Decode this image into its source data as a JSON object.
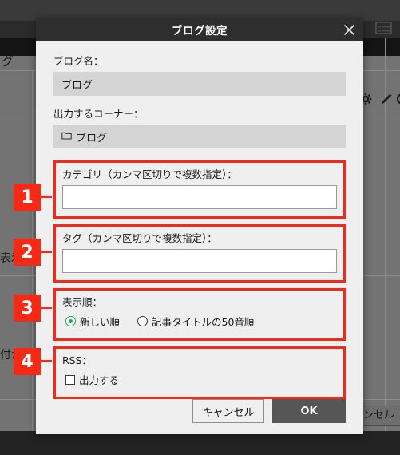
{
  "background": {
    "app_label_partial_top": "グ",
    "app_label_partial_mid": "表示",
    "app_label_partial_low": "付か",
    "cancel_button_partial": "ンセル",
    "icons": {
      "list_icon": "list-icon",
      "gear_icon": "gear-icon",
      "pencil_icon": "pencil-icon",
      "chevron_left_icon": "chevron-left-icon"
    }
  },
  "dialog": {
    "title": "ブログ設定",
    "close_icon": "close-icon",
    "fields": {
      "blog_name": {
        "label": "ブログ名：",
        "value": "ブログ",
        "disabled": true
      },
      "output_corner": {
        "label": "出力するコーナー：",
        "value": "ブログ",
        "icon": "folder-icon",
        "disabled": true
      },
      "category": {
        "label": "カテゴリ（カンマ区切りで複数指定）：",
        "value": "",
        "placeholder": ""
      },
      "tag": {
        "label": "タグ（カンマ区切りで複数指定）：",
        "value": "",
        "placeholder": ""
      },
      "display_order": {
        "label": "表示順：",
        "options": [
          {
            "label": "新しい順",
            "selected": true
          },
          {
            "label": "記事タイトルの50音順",
            "selected": false
          }
        ]
      },
      "rss": {
        "label": "RSS：",
        "options": [
          {
            "label": "出力する",
            "checked": false
          }
        ]
      }
    },
    "footer": {
      "cancel_label": "キャンセル",
      "ok_label": "OK"
    }
  },
  "annotations": {
    "badges": [
      {
        "number": "1",
        "target": "category-field"
      },
      {
        "number": "2",
        "target": "tag-field"
      },
      {
        "number": "3",
        "target": "display-order-field"
      },
      {
        "number": "4",
        "target": "rss-field"
      }
    ],
    "highlight_color": "#f52a16"
  }
}
